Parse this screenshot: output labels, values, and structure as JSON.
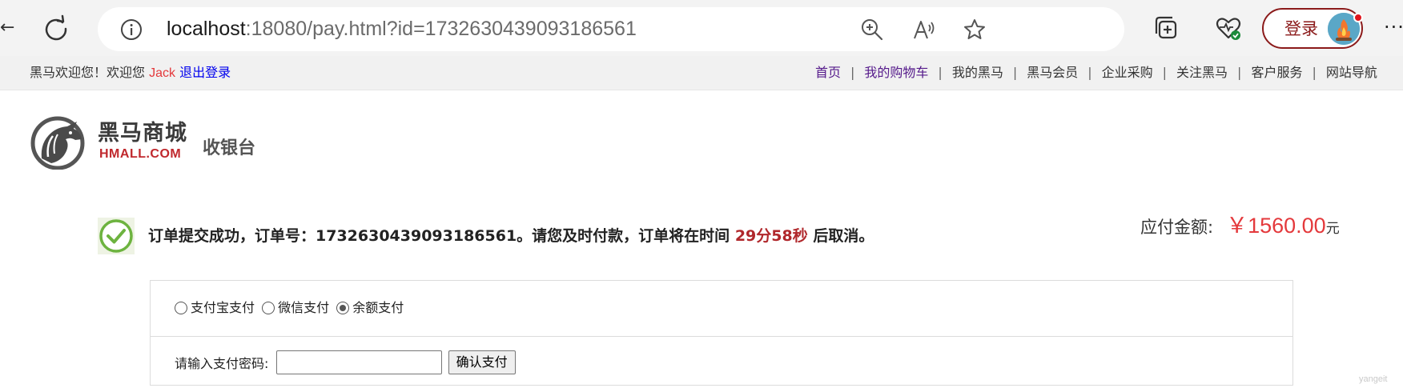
{
  "browser": {
    "url_host": "localhost",
    "url_rest": ":18080/pay.html?id=1732630439093186561",
    "login_label": "登录"
  },
  "topbar": {
    "welcome_prefix": "黑马欢迎您！欢迎您 ",
    "username": "Jack",
    "logout": "退出登录",
    "nav": [
      "首页",
      "我的购物车",
      "我的黑马",
      "黑马会员",
      "企业采购",
      "关注黑马",
      "客户服务",
      "网站导航"
    ]
  },
  "header": {
    "logo_cn": "黑马商城",
    "logo_en": "HMALL.COM",
    "page_title": "收银台"
  },
  "order": {
    "status_prefix": "订单提交成功，订单号：1732630439093186561。请您及时付款，订单将在时间 ",
    "countdown": "29分58秒",
    "status_suffix": " 后取消。",
    "amount_label": "应付金额:",
    "amount_value": "￥1560.00",
    "amount_unit": "元"
  },
  "payment": {
    "methods": [
      {
        "label": "支付宝支付",
        "checked": false
      },
      {
        "label": "微信支付",
        "checked": false
      },
      {
        "label": "余额支付",
        "checked": true
      }
    ],
    "password_label": "请输入支付密码:",
    "confirm_label": "确认支付"
  },
  "watermark": "yangeit",
  "colors": {
    "accent_red": "#e4393c",
    "countdown_red": "#b0272b",
    "login_border": "#8b1a1a"
  }
}
